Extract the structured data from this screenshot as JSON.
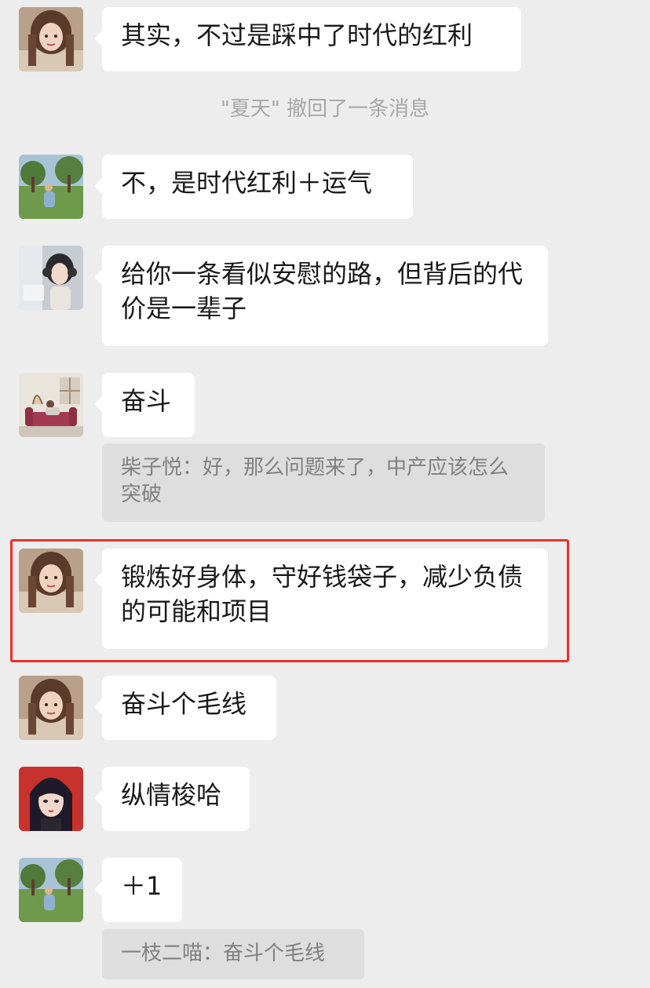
{
  "chat": {
    "messages": [
      {
        "text": "其实，不过是踩中了时代的红利",
        "avatar": "avatar-girl-long-hair"
      },
      {
        "system": "\"夏天\" 撤回了一条消息"
      },
      {
        "text": "不，是时代红利＋运气",
        "avatar": "avatar-park-photo"
      },
      {
        "text": "给你一条看似安慰的路，但背后的代价是一辈子",
        "avatar": "avatar-headphone-girl"
      },
      {
        "text": "奋斗",
        "avatar": "avatar-sofa-illustration",
        "quote": "柴子悦：好，那么问题来了，中产应该怎么突破"
      },
      {
        "text": "锻炼好身体，守好钱袋子，减少负债的可能和项目",
        "avatar": "avatar-girl-long-hair",
        "highlighted": true
      },
      {
        "text": "奋斗个毛线",
        "avatar": "avatar-girl-long-hair"
      },
      {
        "text": "纵情梭哈",
        "avatar": "avatar-anime-girl"
      },
      {
        "text": "＋1",
        "avatar": "avatar-park-photo",
        "quote": "一枝二喵：奋斗个毛线"
      }
    ]
  },
  "colors": {
    "background": "#ededed",
    "bubble": "#ffffff",
    "quote_bg": "#dedede",
    "highlight": "#e8322a"
  }
}
